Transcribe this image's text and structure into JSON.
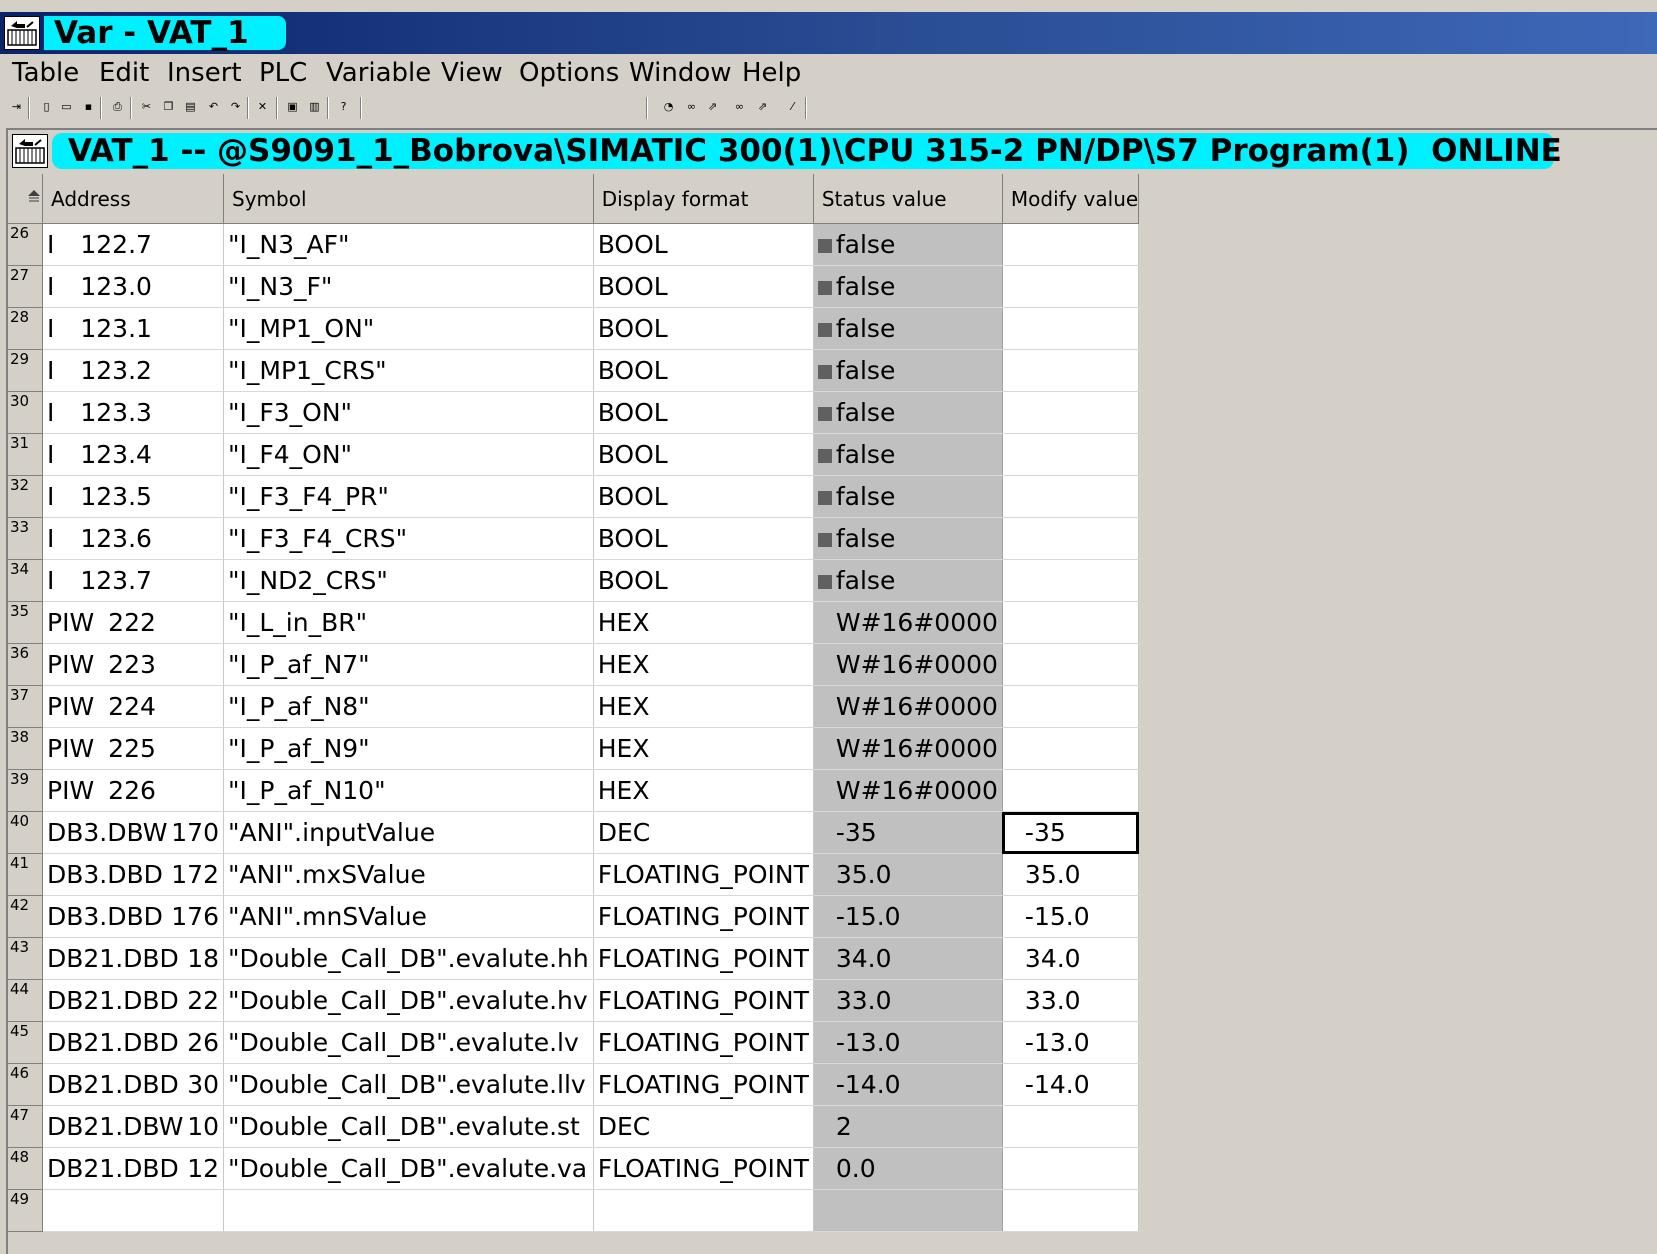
{
  "window": {
    "title": "Var - VAT_1"
  },
  "menu": [
    "Table",
    "Edit",
    "Insert",
    "PLC",
    "Variable",
    "View",
    "Options",
    "Window",
    "Help"
  ],
  "toolbar_left": [
    "pin-icon",
    "new-icon",
    "open-icon",
    "save-icon",
    "print-icon",
    "cut-icon",
    "copy-icon",
    "paste-icon",
    "undo-icon",
    "redo-icon",
    "delete-icon",
    "monitor-icon",
    "modify-icon",
    "help-icon"
  ],
  "toolbar_right": [
    "monitor-variable-icon",
    "monitor-trigger-icon",
    "modify-variable-icon",
    "force-icon",
    "trigger-icon",
    "display-icon"
  ],
  "inner_window": {
    "title": "VAT_1 -- @S9091_1_Bobrova\\SIMATIC 300(1)\\CPU 315-2 PN/DP\\S7 Program(1)  ONLINE"
  },
  "table": {
    "headers": [
      "Address",
      "Symbol",
      "Display format",
      "Status value",
      "Modify value"
    ],
    "rows": [
      {
        "n": "26",
        "addr_pre": "I",
        "addr_num": "122.7",
        "symbol": "\"I_N3_AF\"",
        "format": "BOOL",
        "status": "false",
        "bool": true,
        "modify": ""
      },
      {
        "n": "27",
        "addr_pre": "I",
        "addr_num": "123.0",
        "symbol": "\"I_N3_F\"",
        "format": "BOOL",
        "status": "false",
        "bool": true,
        "modify": ""
      },
      {
        "n": "28",
        "addr_pre": "I",
        "addr_num": "123.1",
        "symbol": "\"I_MP1_ON\"",
        "format": "BOOL",
        "status": "false",
        "bool": true,
        "modify": ""
      },
      {
        "n": "29",
        "addr_pre": "I",
        "addr_num": "123.2",
        "symbol": "\"I_MP1_CRS\"",
        "format": "BOOL",
        "status": "false",
        "bool": true,
        "modify": ""
      },
      {
        "n": "30",
        "addr_pre": "I",
        "addr_num": "123.3",
        "symbol": "\"I_F3_ON\"",
        "format": "BOOL",
        "status": "false",
        "bool": true,
        "modify": ""
      },
      {
        "n": "31",
        "addr_pre": "I",
        "addr_num": "123.4",
        "symbol": "\"I_F4_ON\"",
        "format": "BOOL",
        "status": "false",
        "bool": true,
        "modify": ""
      },
      {
        "n": "32",
        "addr_pre": "I",
        "addr_num": "123.5",
        "symbol": "\"I_F3_F4_PR\"",
        "format": "BOOL",
        "status": "false",
        "bool": true,
        "modify": ""
      },
      {
        "n": "33",
        "addr_pre": "I",
        "addr_num": "123.6",
        "symbol": "\"I_F3_F4_CRS\"",
        "format": "BOOL",
        "status": "false",
        "bool": true,
        "modify": ""
      },
      {
        "n": "34",
        "addr_pre": "I",
        "addr_num": "123.7",
        "symbol": "\"I_ND2_CRS\"",
        "format": "BOOL",
        "status": "false",
        "bool": true,
        "modify": ""
      },
      {
        "n": "35",
        "addr_pre": "PIW",
        "addr_num": "222",
        "symbol": "\"I_L_in_BR\"",
        "format": "HEX",
        "status": "W#16#0000",
        "bool": false,
        "modify": ""
      },
      {
        "n": "36",
        "addr_pre": "PIW",
        "addr_num": "223",
        "symbol": "\"I_P_af_N7\"",
        "format": "HEX",
        "status": "W#16#0000",
        "bool": false,
        "modify": ""
      },
      {
        "n": "37",
        "addr_pre": "PIW",
        "addr_num": "224",
        "symbol": "\"I_P_af_N8\"",
        "format": "HEX",
        "status": "W#16#0000",
        "bool": false,
        "modify": ""
      },
      {
        "n": "38",
        "addr_pre": "PIW",
        "addr_num": "225",
        "symbol": "\"I_P_af_N9\"",
        "format": "HEX",
        "status": "W#16#0000",
        "bool": false,
        "modify": ""
      },
      {
        "n": "39",
        "addr_pre": "PIW",
        "addr_num": "226",
        "symbol": "\"I_P_af_N10\"",
        "format": "HEX",
        "status": "W#16#0000",
        "bool": false,
        "modify": ""
      },
      {
        "n": "40",
        "addr_pre": "DB3.DBW",
        "addr_num": "170",
        "symbol": "\"ANI\".inputValue",
        "format": "DEC",
        "status": "-35",
        "bool": false,
        "modify": "-35",
        "active": true
      },
      {
        "n": "41",
        "addr_pre": "DB3.DBD",
        "addr_num": "172",
        "symbol": "\"ANI\".mxSValue",
        "format": "FLOATING_POINT",
        "status": "35.0",
        "bool": false,
        "modify": "35.0"
      },
      {
        "n": "42",
        "addr_pre": "DB3.DBD",
        "addr_num": "176",
        "symbol": "\"ANI\".mnSValue",
        "format": "FLOATING_POINT",
        "status": "-15.0",
        "bool": false,
        "modify": "-15.0"
      },
      {
        "n": "43",
        "addr_pre": "DB21.DBD",
        "addr_num": "18",
        "symbol": "\"Double_Call_DB\".evalute.hh",
        "format": "FLOATING_POINT",
        "status": "34.0",
        "bool": false,
        "modify": "34.0"
      },
      {
        "n": "44",
        "addr_pre": "DB21.DBD",
        "addr_num": "22",
        "symbol": "\"Double_Call_DB\".evalute.hv",
        "format": "FLOATING_POINT",
        "status": "33.0",
        "bool": false,
        "modify": "33.0"
      },
      {
        "n": "45",
        "addr_pre": "DB21.DBD",
        "addr_num": "26",
        "symbol": "\"Double_Call_DB\".evalute.lv",
        "format": "FLOATING_POINT",
        "status": "-13.0",
        "bool": false,
        "modify": "-13.0"
      },
      {
        "n": "46",
        "addr_pre": "DB21.DBD",
        "addr_num": "30",
        "symbol": "\"Double_Call_DB\".evalute.llv",
        "format": "FLOATING_POINT",
        "status": "-14.0",
        "bool": false,
        "modify": "-14.0"
      },
      {
        "n": "47",
        "addr_pre": "DB21.DBW",
        "addr_num": "10",
        "symbol": "\"Double_Call_DB\".evalute.st",
        "format": "DEC",
        "status": "2",
        "bool": false,
        "modify": ""
      },
      {
        "n": "48",
        "addr_pre": "DB21.DBD",
        "addr_num": "12",
        "symbol": "\"Double_Call_DB\".evalute.va",
        "format": "FLOATING_POINT",
        "status": "0.0",
        "bool": false,
        "modify": ""
      },
      {
        "n": "49",
        "addr_pre": "",
        "addr_num": "",
        "symbol": "",
        "format": "",
        "status": "",
        "bool": false,
        "modify": ""
      }
    ]
  }
}
